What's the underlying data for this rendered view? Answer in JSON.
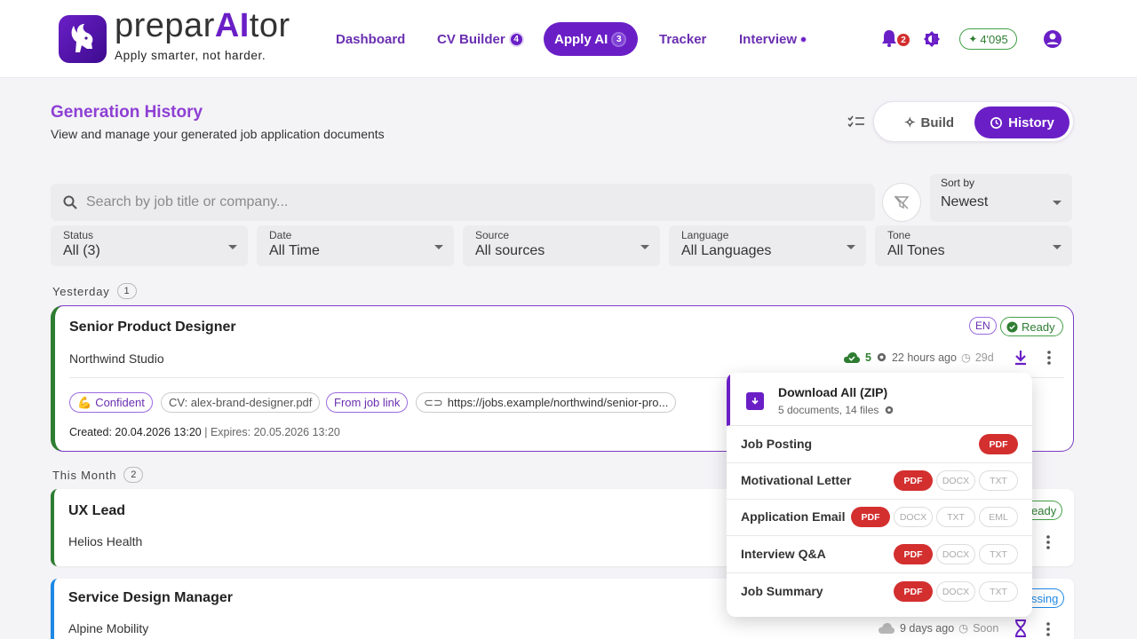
{
  "app": {
    "name_pre": "prepar",
    "name_ai": "AI",
    "name_post": "tor",
    "tagline": "Apply smarter, not harder."
  },
  "nav": {
    "dashboard": "Dashboard",
    "cv_builder": "CV Builder",
    "cv_builder_count": "4",
    "apply_ai": "Apply AI",
    "apply_ai_count": "3",
    "tracker": "Tracker",
    "interview": "Interview"
  },
  "header": {
    "notifications_count": "2",
    "credits": "4'095"
  },
  "page": {
    "title": "Generation History",
    "subtitle": "View and manage your generated job application documents",
    "toggle_build": "Build",
    "toggle_history": "History"
  },
  "filters": {
    "search_placeholder": "Search by job title or company...",
    "sort_label": "Sort by",
    "sort_value": "Newest",
    "status_label": "Status",
    "status_value": "All (3)",
    "date_label": "Date",
    "date_value": "All Time",
    "source_label": "Source",
    "source_value": "All sources",
    "language_label": "Language",
    "language_value": "All Languages",
    "tone_label": "Tone",
    "tone_value": "All Tones"
  },
  "groups": [
    {
      "label": "Yesterday",
      "count": "1"
    },
    {
      "label": "This Month",
      "count": "2"
    }
  ],
  "cards": [
    {
      "title": "Senior Product Designer",
      "company": "Northwind Studio",
      "lang": "EN",
      "status": "Ready",
      "docs_count": "5",
      "time_ago": "22 hours ago",
      "expires_in": "29d",
      "tone": "Confident",
      "cv": "CV: alex-brand-designer.pdf",
      "source": "From job link",
      "url": "https://jobs.example/northwind/senior-pro...",
      "created": "Created: 20.04.2026 13:20",
      "expires": "| Expires: 20.05.2026 13:20"
    },
    {
      "title": "UX Lead",
      "company": "Helios Health",
      "status_partial": "eady"
    },
    {
      "title": "Service Design Manager",
      "company": "Alpine Mobility",
      "status_partial": "ssing",
      "time_ago": "9 days ago",
      "expires_in": "Soon"
    }
  ],
  "download_menu": {
    "title": "Download All (ZIP)",
    "subtitle": "5 documents, 14 files",
    "rows": [
      {
        "name": "Job Posting",
        "formats": [
          "PDF"
        ]
      },
      {
        "name": "Motivational Letter",
        "formats": [
          "PDF",
          "DOCX",
          "TXT"
        ]
      },
      {
        "name": "Application Email",
        "formats": [
          "PDF",
          "DOCX",
          "TXT",
          "EML"
        ]
      },
      {
        "name": "Interview Q&A",
        "formats": [
          "PDF",
          "DOCX",
          "TXT"
        ]
      },
      {
        "name": "Job Summary",
        "formats": [
          "PDF",
          "DOCX",
          "TXT"
        ]
      }
    ]
  },
  "colors": {
    "brand": "#6a1fc6",
    "ready": "#2e7d32",
    "pdf": "#d32f2f",
    "processing": "#1e88e5"
  }
}
